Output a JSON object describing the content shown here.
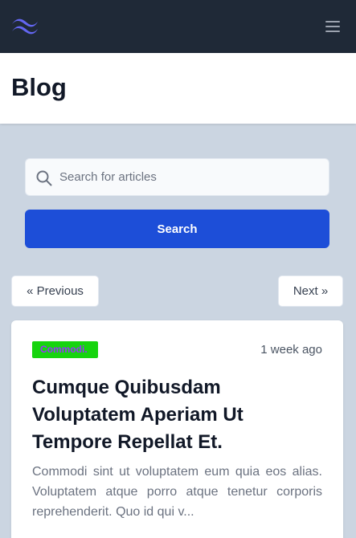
{
  "nav": {
    "logo_icon": "tailwind-logo-icon",
    "menu_icon": "hamburger-menu-icon",
    "logo_color": "#6366f1",
    "background": "#1f2937"
  },
  "header": {
    "title": "Blog"
  },
  "search": {
    "placeholder": "Search for articles",
    "value": "",
    "icon": "search-icon",
    "button_label": "Search",
    "button_color": "#1d4ed8"
  },
  "pagination": {
    "previous_label": "« Previous",
    "next_label": "Next »"
  },
  "article": {
    "category": "Commodi.",
    "time": "1 week ago",
    "title": "Cumque Quibusdam Voluptatem Aperiam Ut Tempore Repellat Et.",
    "excerpt": "Commodi sint ut voluptatem eum quia eos alias. Voluptatem atque porro atque tenetur corporis reprehenderit. Quo id qui v..."
  }
}
